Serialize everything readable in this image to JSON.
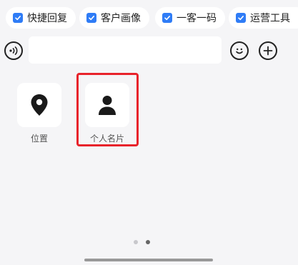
{
  "quick_chips": [
    {
      "label": "快捷回复"
    },
    {
      "label": "客户画像"
    },
    {
      "label": "一客一码"
    },
    {
      "label": "运营工具"
    }
  ],
  "toolbar": {
    "voice_icon": "voice-wave-icon",
    "input_value": "",
    "emoji_icon": "smiley-icon",
    "plus_icon": "plus-icon"
  },
  "panel": {
    "items": [
      {
        "label": "位置",
        "icon": "location-pin-icon"
      },
      {
        "label": "个人名片",
        "icon": "person-card-icon"
      }
    ],
    "page_indicator": {
      "pages": 2,
      "current": 2
    }
  },
  "colors": {
    "accent": "#2f7cf6",
    "highlight": "#e8232b",
    "background": "#f5f5f7"
  }
}
